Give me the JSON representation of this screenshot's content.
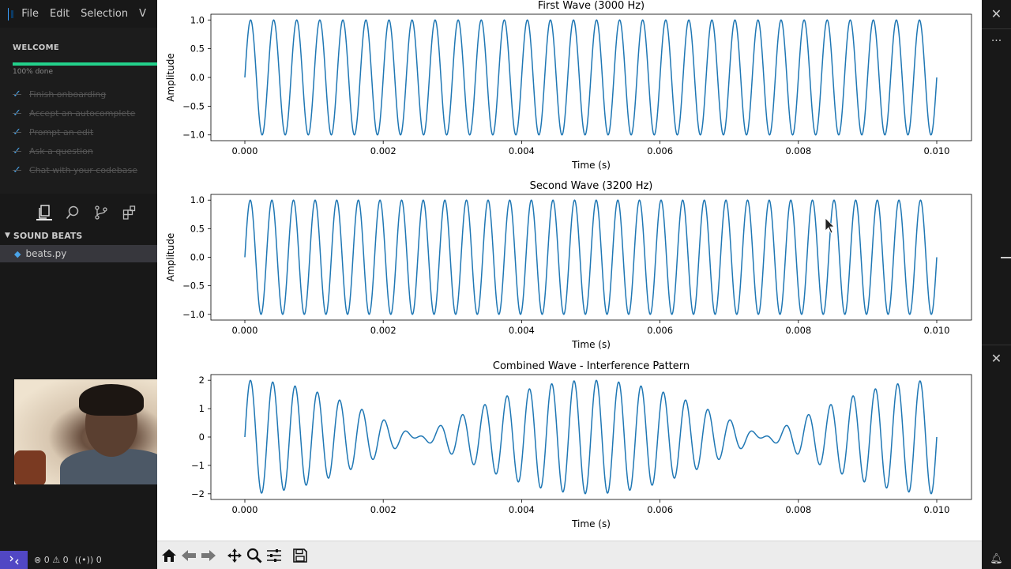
{
  "menubar": {
    "items": [
      "File",
      "Edit",
      "Selection",
      "V"
    ]
  },
  "welcome": {
    "title": "WELCOME",
    "progress": 1.0,
    "progress_text": "100% done",
    "checklist": [
      "Finish onboarding",
      "Accept an autocomplete",
      "Prompt an edit",
      "Ask a question",
      "Chat with your codebase"
    ]
  },
  "activity_bar": {
    "icons": [
      "files-icon",
      "search-icon",
      "source-control-icon",
      "extensions-icon"
    ]
  },
  "explorer": {
    "folder": "SOUND BEATS",
    "file": "beats.py"
  },
  "statusbar": {
    "remote_icon": "remote-icon",
    "problems": "0 ⚠ 0",
    "errors": "0",
    "warnings": "0",
    "ports": "0"
  },
  "colors": {
    "accent": "#23d18b",
    "line": "#1f77b4"
  },
  "chart_data": [
    {
      "type": "line",
      "title": "First Wave (3000 Hz)",
      "xlabel": "Time (s)",
      "ylabel": "Amplitude",
      "xlim": [
        0,
        0.01
      ],
      "ylim": [
        -1.1,
        1.1
      ],
      "xticks": [
        "0.000",
        "0.002",
        "0.004",
        "0.006",
        "0.008",
        "0.010"
      ],
      "yticks": [
        "1.0",
        "0.5",
        "0.0",
        "−0.5",
        "−1.0"
      ],
      "ytick_values": [
        1.0,
        0.5,
        0.0,
        -0.5,
        -1.0
      ],
      "series": [
        {
          "function": "sin(2*pi*3000*t)",
          "frequency": 3000,
          "amplitude": 1.0
        }
      ]
    },
    {
      "type": "line",
      "title": "Second Wave (3200 Hz)",
      "xlabel": "Time (s)",
      "ylabel": "Amplitude",
      "xlim": [
        0,
        0.01
      ],
      "ylim": [
        -1.1,
        1.1
      ],
      "xticks": [
        "0.000",
        "0.002",
        "0.004",
        "0.006",
        "0.008",
        "0.010"
      ],
      "yticks": [
        "1.0",
        "0.5",
        "0.0",
        "−0.5",
        "−1.0"
      ],
      "ytick_values": [
        1.0,
        0.5,
        0.0,
        -0.5,
        -1.0
      ],
      "series": [
        {
          "function": "sin(2*pi*3200*t)",
          "frequency": 3200,
          "amplitude": 1.0
        }
      ]
    },
    {
      "type": "line",
      "title": "Combined Wave - Interference Pattern",
      "xlabel": "Time (s)",
      "ylabel": "",
      "xlim": [
        0,
        0.01
      ],
      "ylim": [
        -2.2,
        2.2
      ],
      "xticks": [
        "0.000",
        "0.002",
        "0.004",
        "0.006",
        "0.008",
        "0.010"
      ],
      "yticks": [
        "2",
        "1",
        "0",
        "−1",
        "−2"
      ],
      "ytick_values": [
        2,
        1,
        0,
        -1,
        -2
      ],
      "series": [
        {
          "function": "sin(2*pi*3000*t) + sin(2*pi*3200*t)",
          "frequencies": [
            3000,
            3200
          ]
        }
      ]
    }
  ],
  "toolbar": {
    "buttons": [
      "home-icon",
      "back-icon",
      "forward-icon",
      "pan-icon",
      "zoom-icon",
      "configure-icon",
      "save-icon"
    ]
  }
}
